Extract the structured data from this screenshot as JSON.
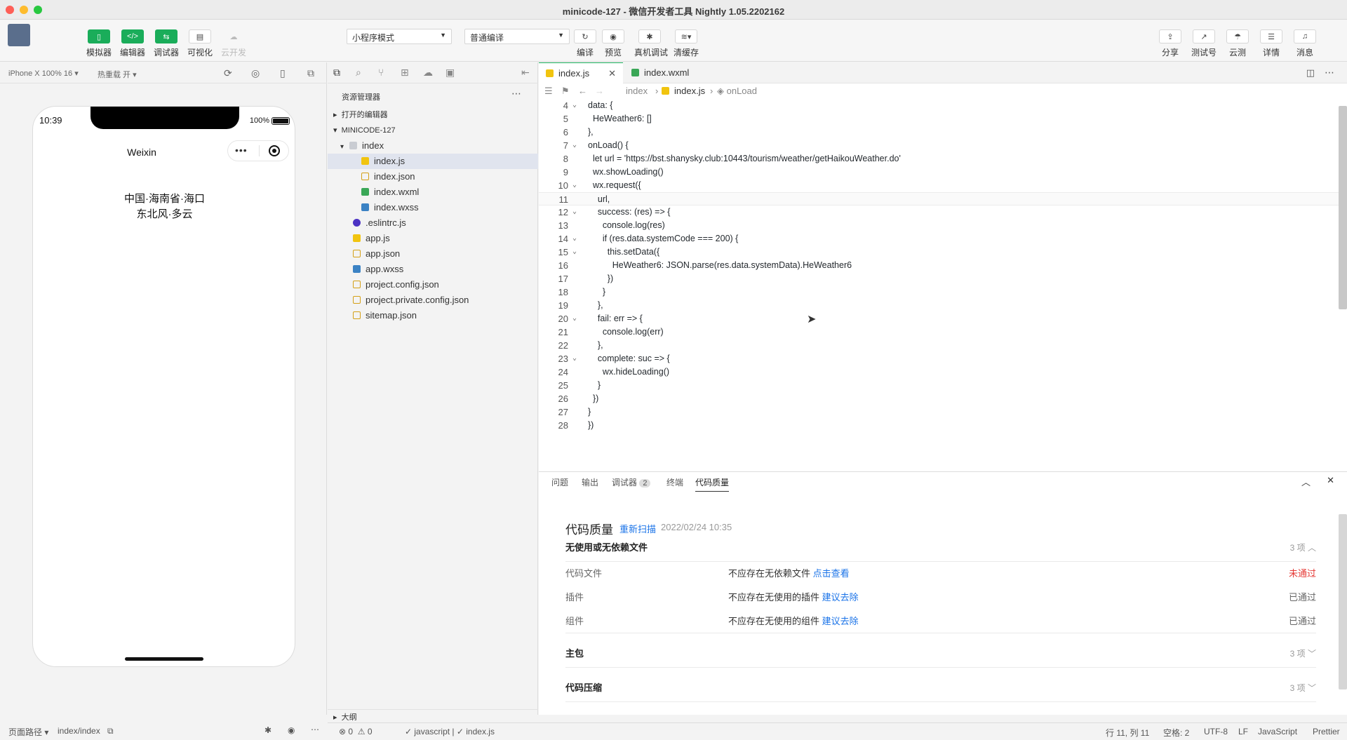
{
  "window": {
    "title": "minicode-127 - 微信开发者工具 Nightly 1.05.2202162"
  },
  "toolbar": {
    "simulator": "模拟器",
    "editor": "编辑器",
    "debugger": "调试器",
    "visual": "可视化",
    "cloud": "云开发",
    "mode_select": "小程序模式",
    "compile_select": "普通编译",
    "compile": "编译",
    "preview": "预览",
    "remote_debug": "真机调试",
    "clear_cache": "清缓存",
    "share": "分享",
    "test_account": "测试号",
    "cloud_test": "云测",
    "details": "详情",
    "messages": "消息"
  },
  "simulator": {
    "device": "iPhone X 100% 16",
    "hot_reload": "热重载 开",
    "time": "10:39",
    "battery": "100%",
    "nav_title": "Weixin",
    "line1": "中国·海南省·海口",
    "line2": "东北风·多云"
  },
  "sim_footer": {
    "path_label": "页面路径",
    "path": "index/index"
  },
  "explorer": {
    "title": "资源管理器",
    "open_editors": "打开的编辑器",
    "project": "MINICODE-127",
    "outline": "大纲",
    "items": [
      {
        "label": "index",
        "type": "folder"
      },
      {
        "label": "index.js",
        "type": "js"
      },
      {
        "label": "index.json",
        "type": "json"
      },
      {
        "label": "index.wxml",
        "type": "wxml"
      },
      {
        "label": "index.wxss",
        "type": "wxss"
      },
      {
        "label": ".eslintrc.js",
        "type": "eslint"
      },
      {
        "label": "app.js",
        "type": "js"
      },
      {
        "label": "app.json",
        "type": "json"
      },
      {
        "label": "app.wxss",
        "type": "wxss"
      },
      {
        "label": "project.config.json",
        "type": "json"
      },
      {
        "label": "project.private.config.json",
        "type": "json"
      },
      {
        "label": "sitemap.json",
        "type": "json"
      }
    ]
  },
  "editor": {
    "tabs": [
      "index.js",
      "index.wxml"
    ],
    "breadcrumb": [
      "index",
      "index.js",
      "onLoad"
    ],
    "lines": [
      {
        "n": "4",
        "fold": true,
        "text": "data: {"
      },
      {
        "n": "5",
        "fold": false,
        "text": "  HeWeather6: []"
      },
      {
        "n": "6",
        "fold": false,
        "text": "},"
      },
      {
        "n": "7",
        "fold": true,
        "text": "onLoad() {"
      },
      {
        "n": "8",
        "fold": false,
        "text": "  let url = 'https://bst.shanysky.club:10443/tourism/weather/getHaikouWeather.do'"
      },
      {
        "n": "9",
        "fold": false,
        "text": "  wx.showLoading()"
      },
      {
        "n": "10",
        "fold": true,
        "text": "  wx.request({"
      },
      {
        "n": "11",
        "fold": false,
        "text": "    url,"
      },
      {
        "n": "12",
        "fold": true,
        "text": "    success: (res) => {"
      },
      {
        "n": "13",
        "fold": false,
        "text": "      console.log(res)"
      },
      {
        "n": "14",
        "fold": true,
        "text": "      if (res.data.systemCode === 200) {"
      },
      {
        "n": "15",
        "fold": true,
        "text": "        this.setData({"
      },
      {
        "n": "16",
        "fold": false,
        "text": "          HeWeather6: JSON.parse(res.data.systemData).HeWeather6"
      },
      {
        "n": "17",
        "fold": false,
        "text": "        })"
      },
      {
        "n": "18",
        "fold": false,
        "text": "      }"
      },
      {
        "n": "19",
        "fold": false,
        "text": "    },"
      },
      {
        "n": "20",
        "fold": true,
        "text": "    fail: err => {"
      },
      {
        "n": "21",
        "fold": false,
        "text": "      console.log(err)"
      },
      {
        "n": "22",
        "fold": false,
        "text": "    },"
      },
      {
        "n": "23",
        "fold": true,
        "text": "    complete: suc => {"
      },
      {
        "n": "24",
        "fold": false,
        "text": "      wx.hideLoading()"
      },
      {
        "n": "25",
        "fold": false,
        "text": "    }"
      },
      {
        "n": "26",
        "fold": false,
        "text": "  })"
      },
      {
        "n": "27",
        "fold": false,
        "text": "}"
      },
      {
        "n": "28",
        "fold": false,
        "text": "})"
      }
    ]
  },
  "panel": {
    "tabs": [
      "问题",
      "输出",
      "调试器",
      "终端",
      "代码质量"
    ],
    "debugger_badge": "2",
    "title": "代码质量",
    "rescan": "重新扫描",
    "timestamp": "2022/02/24 10:35",
    "section1": {
      "title": "无使用或无依赖文件",
      "count": "3 项"
    },
    "rows": [
      {
        "name": "代码文件",
        "desc": "不应存在无依赖文件",
        "link": "点击查看",
        "status": "未通过"
      },
      {
        "name": "插件",
        "desc": "不应存在无使用的插件",
        "link": "建议去除",
        "status": "已通过"
      },
      {
        "name": "组件",
        "desc": "不应存在无使用的组件",
        "link": "建议去除",
        "status": "已通过"
      }
    ],
    "section2": {
      "title": "主包",
      "count": "3 项"
    },
    "section3": {
      "title": "代码压缩",
      "count": "3 项"
    }
  },
  "statusbar": {
    "errors": "0",
    "warnings": "0",
    "language_hint": "javascript",
    "file_hint": "index.js",
    "position": "行 11, 列 11",
    "spaces": "空格: 2",
    "encoding": "UTF-8",
    "eol": "LF",
    "language": "JavaScript",
    "formatter": "Prettier"
  },
  "colors": {
    "accent": "#1aad5a",
    "fail": "#e53935",
    "link": "#1a73e8"
  }
}
